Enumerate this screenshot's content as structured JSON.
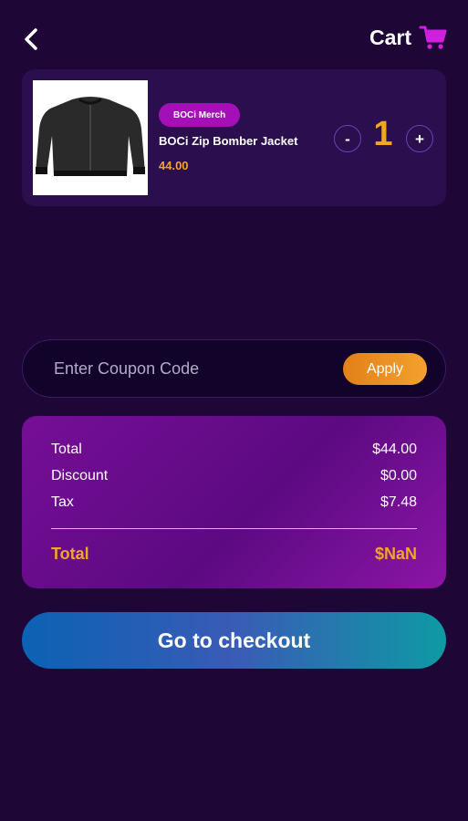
{
  "header": {
    "title": "Cart",
    "back_icon": "chevron-left-icon",
    "cart_icon": "shopping-cart-icon",
    "cart_icon_color": "#d11fe0"
  },
  "cart": {
    "items": [
      {
        "category": "BOCi Merch",
        "name": "BOCi Zip Bomber Jacket",
        "price": "44.00",
        "quantity": "1",
        "minus_label": "-",
        "plus_label": "+",
        "image_icon": "bomber-jacket-image"
      }
    ]
  },
  "coupon": {
    "placeholder": "Enter Coupon Code",
    "value": "",
    "apply_label": "Apply"
  },
  "summary": {
    "total_label": "Total",
    "total_value": "$44.00",
    "discount_label": "Discount",
    "discount_value": "$0.00",
    "tax_label": "Tax",
    "tax_value": "$7.48",
    "grand_total_label": "Total",
    "grand_total_value": "$NaN"
  },
  "checkout": {
    "label": "Go to checkout"
  },
  "colors": {
    "background": "#1e0637",
    "accent_orange": "#f3a524",
    "badge_purple": "#a40fb8",
    "summary_purple": "#760e96",
    "checkout_blue": "#0b62b4",
    "checkout_teal": "#0e9aa4"
  }
}
